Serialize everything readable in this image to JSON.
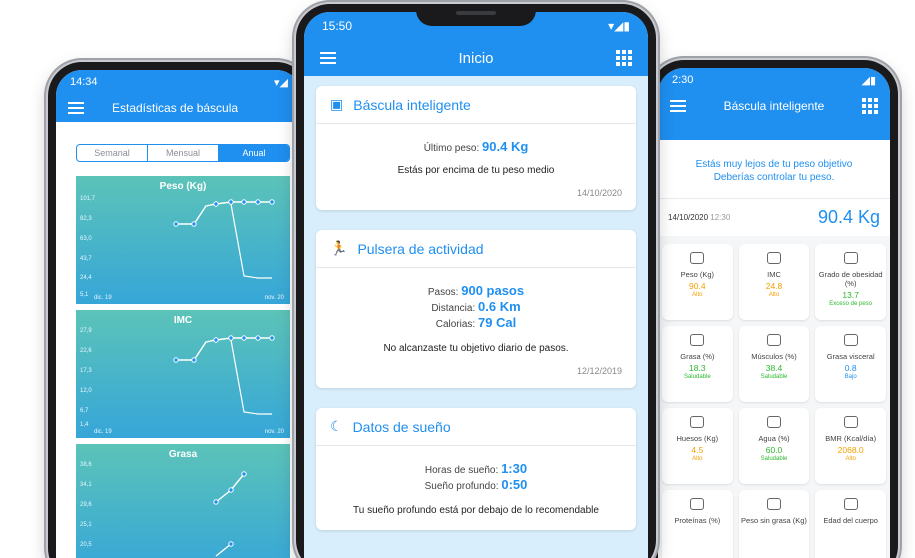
{
  "left_phone": {
    "status_time": "14:34",
    "title": "Estadísticas de báscula",
    "segments": [
      "Semanal",
      "Mensual",
      "Anual"
    ],
    "charts": [
      {
        "title": "Peso (Kg)",
        "yticks": [
          "101,7",
          "82,3",
          "63,0",
          "43,7",
          "24,4",
          "5,1"
        ],
        "x_start": "dic. 19",
        "x_end": "nov. 20"
      },
      {
        "title": "IMC",
        "yticks": [
          "27,9",
          "22,6",
          "17,3",
          "12,0",
          "6,7",
          "1,4"
        ],
        "x_start": "dic. 19",
        "x_end": "nov. 20"
      },
      {
        "title": "Grasa",
        "yticks": [
          "38,6",
          "34,1",
          "29,6",
          "25,1",
          "20,5"
        ]
      }
    ]
  },
  "center_phone": {
    "status_time": "15:50",
    "title": "Inicio",
    "scale_card": {
      "title": "Báscula inteligente",
      "last_weight_label": "Último peso:",
      "last_weight_value": "90.4 Kg",
      "note": "Estás por encima de tu peso medio",
      "date": "14/10/2020"
    },
    "band_card": {
      "title": "Pulsera de actividad",
      "steps_label": "Pasos:",
      "steps_value": "900 pasos",
      "distance_label": "Distancia:",
      "distance_value": "0.6 Km",
      "calories_label": "Calorias:",
      "calories_value": "79 Cal",
      "note": "No alcanzaste tu objetivo diario de pasos.",
      "date": "12/12/2019"
    },
    "sleep_card": {
      "title": "Datos de sueño",
      "hours_label": "Horas de sueño:",
      "hours_value": "1:30",
      "deep_label": "Sueño profundo:",
      "deep_value": "0:50",
      "note": "Tu sueño profundo está por debajo de lo recomendable"
    }
  },
  "right_phone": {
    "status_time": "2:30",
    "title": "Báscula inteligente",
    "message_line1": "Estás muy lejos de tu peso objetivo",
    "message_line2": "Deberías controlar tu peso.",
    "weigh_date": "14/10/2020",
    "weigh_time": "12:30",
    "weigh_value": "90.4 Kg",
    "tiles": [
      {
        "label": "Peso (Kg)",
        "value": "90.4",
        "status": "Alto",
        "color": "#f5a000"
      },
      {
        "label": "IMC",
        "value": "24.8",
        "status": "Alto",
        "color": "#f5a000"
      },
      {
        "label": "Grado de obesidad (%)",
        "value": "13.7",
        "status": "Exceso de peso",
        "color": "#2eb82e"
      },
      {
        "label": "Grasa (%)",
        "value": "18.3",
        "status": "Saludable",
        "color": "#2eb82e"
      },
      {
        "label": "Músculos (%)",
        "value": "38.4",
        "status": "Saludable",
        "color": "#2eb82e"
      },
      {
        "label": "Grasa visceral",
        "value": "0.8",
        "status": "Bajo",
        "color": "#1f8ff0"
      },
      {
        "label": "Huesos (Kg)",
        "value": "4.5",
        "status": "Alto",
        "color": "#f5a000"
      },
      {
        "label": "Agua (%)",
        "value": "60.0",
        "status": "Saludable",
        "color": "#2eb82e"
      },
      {
        "label": "BMR (Kcal/día)",
        "value": "2068.0",
        "status": "Alto",
        "color": "#f5a000"
      },
      {
        "label": "Proteínas (%)",
        "value": "",
        "status": "",
        "color": "#2eb82e"
      },
      {
        "label": "Peso sin grasa (Kg)",
        "value": "",
        "status": "",
        "color": "#2eb82e"
      },
      {
        "label": "Edad del cuerpo",
        "value": "",
        "status": "",
        "color": "#2eb82e"
      }
    ]
  }
}
